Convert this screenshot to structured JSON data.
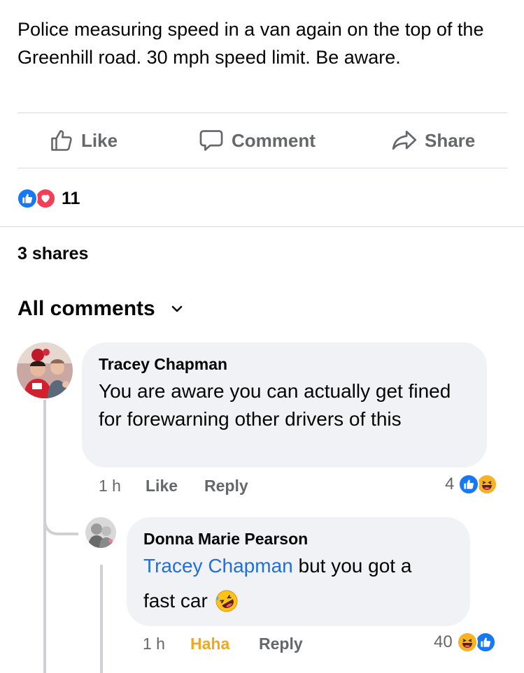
{
  "post": {
    "text": "Police measuring speed in a van again on the top of the Greenhill road. 30 mph speed limit. Be aware."
  },
  "actions": {
    "like_label": "Like",
    "comment_label": "Comment",
    "share_label": "Share"
  },
  "reactions": {
    "count": "11",
    "types": [
      "like-icon",
      "love-icon"
    ]
  },
  "shares_text": "3 shares",
  "comments_filter": "All comments",
  "comments": [
    {
      "author": "Tracey Chapman",
      "text": "You are aware you can actually get fined for forewarning other drivers of this",
      "time": "1 h",
      "like_label": "Like",
      "reply_label": "Reply",
      "reaction_count": "4",
      "reaction_types": [
        "like-icon",
        "haha-icon"
      ]
    },
    {
      "author": "Donna Marie Pearson",
      "mention": "Tracey Chapman",
      "text_after_mention": " but you got a",
      "text_line2": "fast car",
      "emoji": "rolling-on-floor-laughing-icon",
      "time": "1 h",
      "reaction_label": "Haha",
      "reply_label": "Reply",
      "reaction_count": "40",
      "reaction_types": [
        "haha-icon",
        "like-icon"
      ]
    }
  ],
  "colors": {
    "accent_blue": "#1877f2",
    "love_red": "#f33e58",
    "haha_yellow": "#f7b125",
    "haha_label": "#f0a820",
    "mention_blue": "#216fdb",
    "muted": "#65676b"
  }
}
